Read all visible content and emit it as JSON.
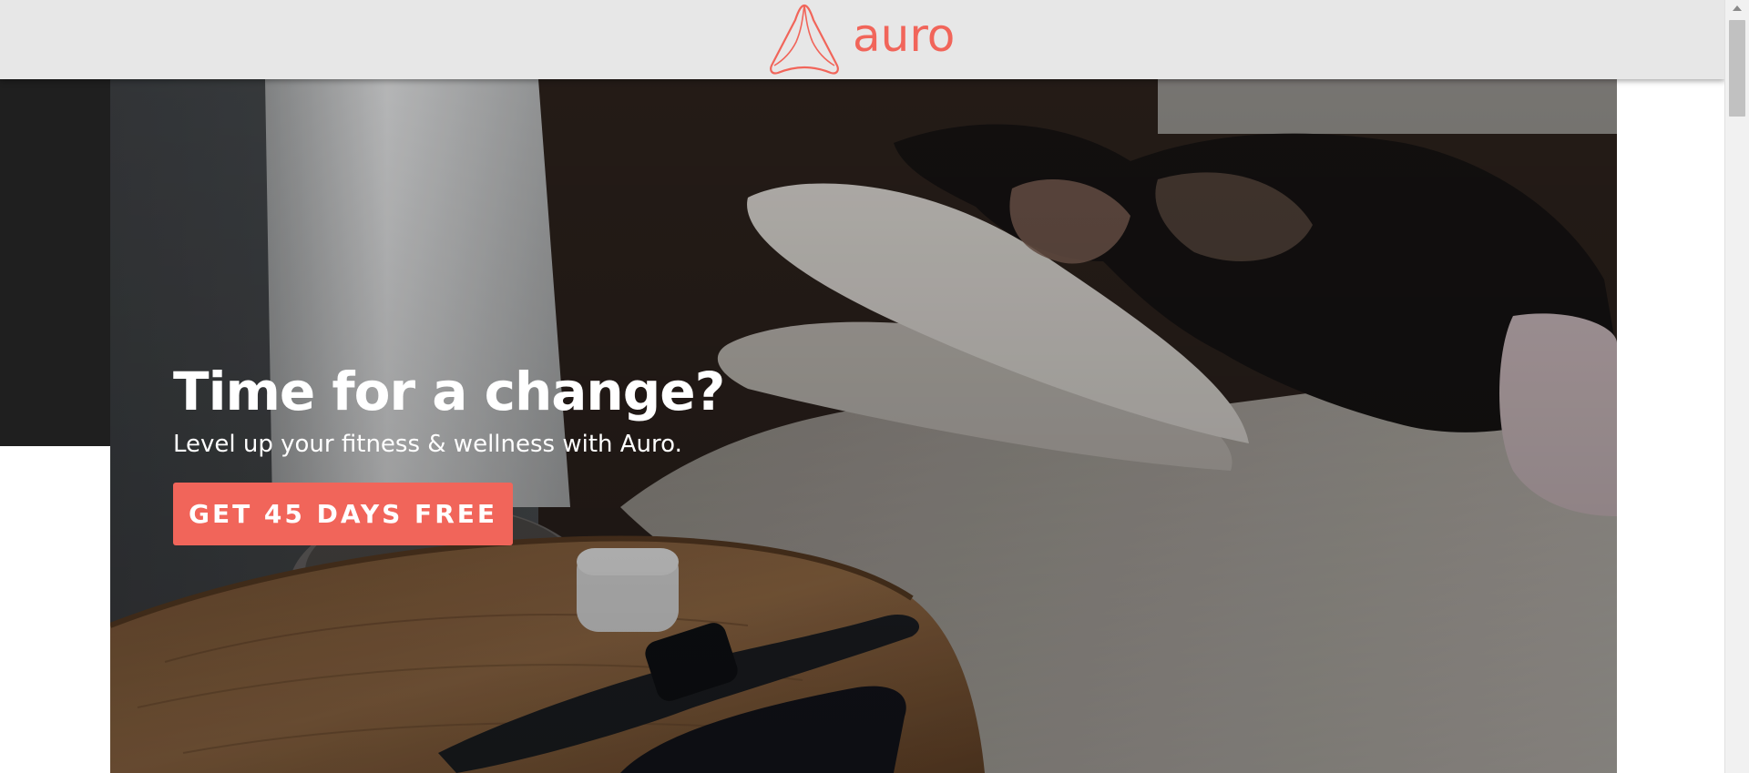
{
  "header": {
    "logo_text": "auro",
    "logo_icon": "auro-triangle-logo-icon"
  },
  "hero": {
    "title": "Time for a change?",
    "subtitle": "Level up your fitness & wellness with Auro.",
    "cta_label": "GET 45 DAYS FREE",
    "background": "hero-video-woman-sleeping-nightstand-watch"
  },
  "colors": {
    "brand": "#f1655a",
    "header_bg": "#e7e7e7",
    "side_block": "#1f1f1f",
    "hero_text": "#ffffff"
  }
}
